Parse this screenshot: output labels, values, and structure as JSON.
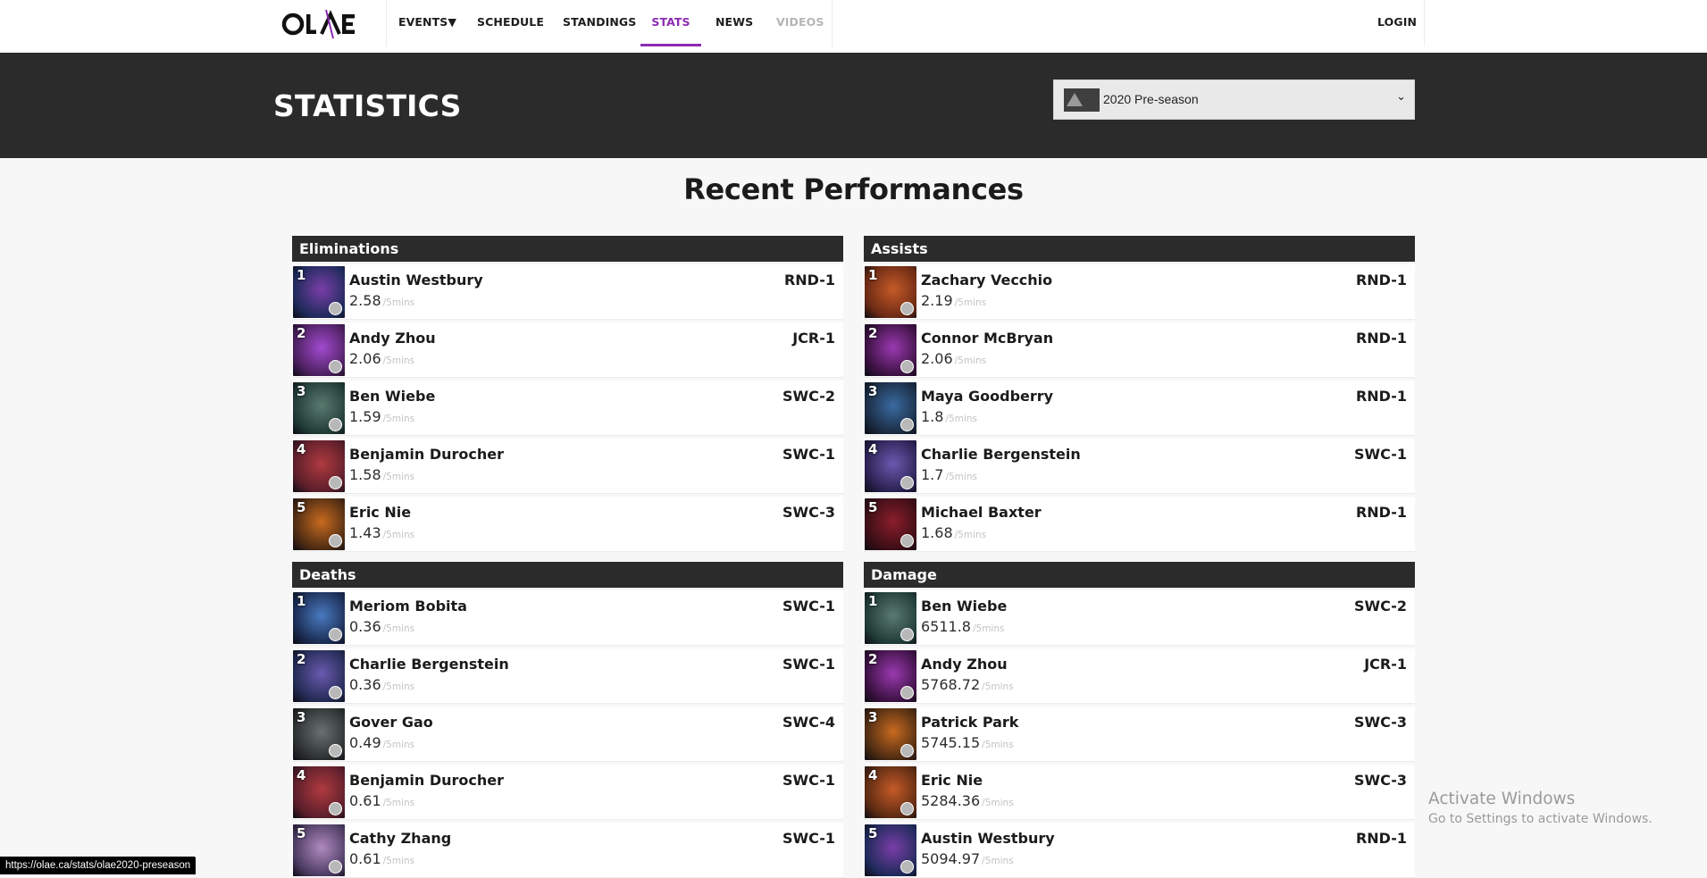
{
  "nav": {
    "logo_text": "OLAE",
    "items": [
      {
        "label": "EVENTS▼"
      },
      {
        "label": "SCHEDULE"
      },
      {
        "label": "STANDINGS"
      },
      {
        "label": "STATS"
      },
      {
        "label": "NEWS"
      },
      {
        "label": "VIDEOS"
      }
    ],
    "login": "LOGIN",
    "accent": "#8d2bb3"
  },
  "header": {
    "title": "STATISTICS",
    "season_select": {
      "selected": "2020 Pre-season"
    }
  },
  "main": {
    "heading": "Recent Performances",
    "unit": "/5mins",
    "panels": [
      {
        "title": "Eliminations",
        "rows": [
          {
            "rank": "1",
            "player": "Austin Westbury",
            "value": "2.58",
            "team": "RND-1"
          },
          {
            "rank": "2",
            "player": "Andy Zhou",
            "value": "2.06",
            "team": "JCR-1"
          },
          {
            "rank": "3",
            "player": "Ben Wiebe",
            "value": "1.59",
            "team": "SWC-2"
          },
          {
            "rank": "4",
            "player": "Benjamin Durocher",
            "value": "1.58",
            "team": "SWC-1"
          },
          {
            "rank": "5",
            "player": "Eric Nie",
            "value": "1.43",
            "team": "SWC-3"
          }
        ]
      },
      {
        "title": "Assists",
        "rows": [
          {
            "rank": "1",
            "player": "Zachary Vecchio",
            "value": "2.19",
            "team": "RND-1"
          },
          {
            "rank": "2",
            "player": "Connor McBryan",
            "value": "2.06",
            "team": "RND-1"
          },
          {
            "rank": "3",
            "player": "Maya Goodberry",
            "value": "1.8",
            "team": "RND-1"
          },
          {
            "rank": "4",
            "player": "Charlie Bergenstein",
            "value": "1.7",
            "team": "SWC-1"
          },
          {
            "rank": "5",
            "player": "Michael Baxter",
            "value": "1.68",
            "team": "RND-1"
          }
        ]
      },
      {
        "title": "Deaths",
        "rows": [
          {
            "rank": "1",
            "player": "Meriom Bobita",
            "value": "0.36",
            "team": "SWC-1"
          },
          {
            "rank": "2",
            "player": "Charlie Bergenstein",
            "value": "0.36",
            "team": "SWC-1"
          },
          {
            "rank": "3",
            "player": "Gover Gao",
            "value": "0.49",
            "team": "SWC-4"
          },
          {
            "rank": "4",
            "player": "Benjamin Durocher",
            "value": "0.61",
            "team": "SWC-1"
          },
          {
            "rank": "5",
            "player": "Cathy Zhang",
            "value": "0.61",
            "team": "SWC-1"
          }
        ]
      },
      {
        "title": "Damage",
        "rows": [
          {
            "rank": "1",
            "player": "Ben Wiebe",
            "value": "6511.8",
            "team": "SWC-2"
          },
          {
            "rank": "2",
            "player": "Andy Zhou",
            "value": "5768.72",
            "team": "JCR-1"
          },
          {
            "rank": "3",
            "player": "Patrick Park",
            "value": "5745.15",
            "team": "SWC-3"
          },
          {
            "rank": "4",
            "player": "Eric Nie",
            "value": "5284.36",
            "team": "SWC-3"
          },
          {
            "rank": "5",
            "player": "Austin Westbury",
            "value": "5094.97",
            "team": "RND-1"
          }
        ]
      }
    ]
  },
  "status_bar": {
    "url": "https://olae.ca/stats/olae2020-preseason"
  },
  "watermark": {
    "title": "Activate Windows",
    "subtitle": "Go to Settings to activate Windows."
  }
}
